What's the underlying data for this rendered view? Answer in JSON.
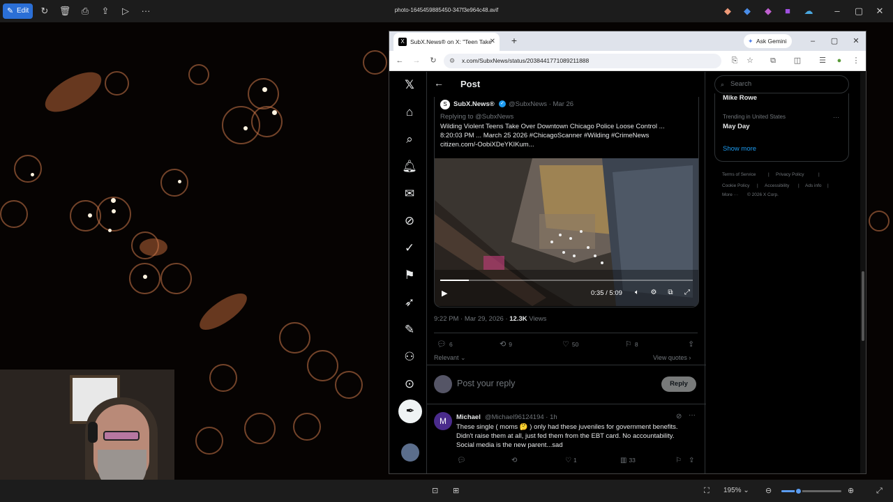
{
  "viewer": {
    "edit_label": "Edit",
    "file_title": "photo-1645459885450-347f3e964c48.avif",
    "zoom_level": "195%",
    "zoom_fraction": 0.28
  },
  "browser": {
    "tab_title": "SubX.News® on X: \"Teen Take",
    "tab_favicon": "X",
    "new_tab": "+",
    "gemini_label": "Ask Gemini",
    "url": "x.com/SubxNews/status/2038441771089211888"
  },
  "x": {
    "page_title": "Post",
    "quoted": {
      "avatar": "S",
      "name": "SubX.News®",
      "handle": "@SubxNews · Mar 26",
      "replying_to": "Replying to @SubxNews",
      "text_lines": [
        "Wilding Violent Teens Take Over Downtown Chicago Police Loose Control ...",
        "8:20:03 PM ... March 25 2026 #ChicagoScanner #Wilding #CrimeNews",
        "citizen.com/-OobiXDeYKIKum..."
      ],
      "video_time": "0:35 / 5:09",
      "video_progress": 0.113
    },
    "meta": {
      "time": "9:22 PM · Mar 29, 2026 · ",
      "views": "12.3K",
      "views_label": " Views"
    },
    "actions": {
      "replies": "6",
      "reposts": "9",
      "likes": "50",
      "bookmarks": "8"
    },
    "relevant_label": "Relevant",
    "view_quotes_label": "View quotes ›",
    "reply_placeholder": "Post your reply",
    "reply_button": "Reply",
    "comment": {
      "avatar_letter": "M",
      "name": "Michael",
      "handle": "@Michael96124194 · 1h",
      "text_lines": [
        "These single ( moms 🤔 ) only had these juveniles for government benefits.",
        "Didn't raise them at all, just fed them from the EBT card. No accountability.",
        "Social media is the new parent...sad"
      ],
      "likes": "1",
      "views": "33"
    },
    "right": {
      "search_placeholder": "Search",
      "trend1": "Mike Rowe",
      "trend2_category": "Trending in United States",
      "trend2": "May Day",
      "trend2_more": "···",
      "show_more": "Show more",
      "footer": {
        "terms": "Terms of Service",
        "privacy": "Privacy Policy",
        "cookie": "Cookie Policy",
        "accessibility": "Accessibility",
        "ads": "Ads info",
        "more": "More ···",
        "copyright": "© 2026 X Corp."
      }
    }
  }
}
